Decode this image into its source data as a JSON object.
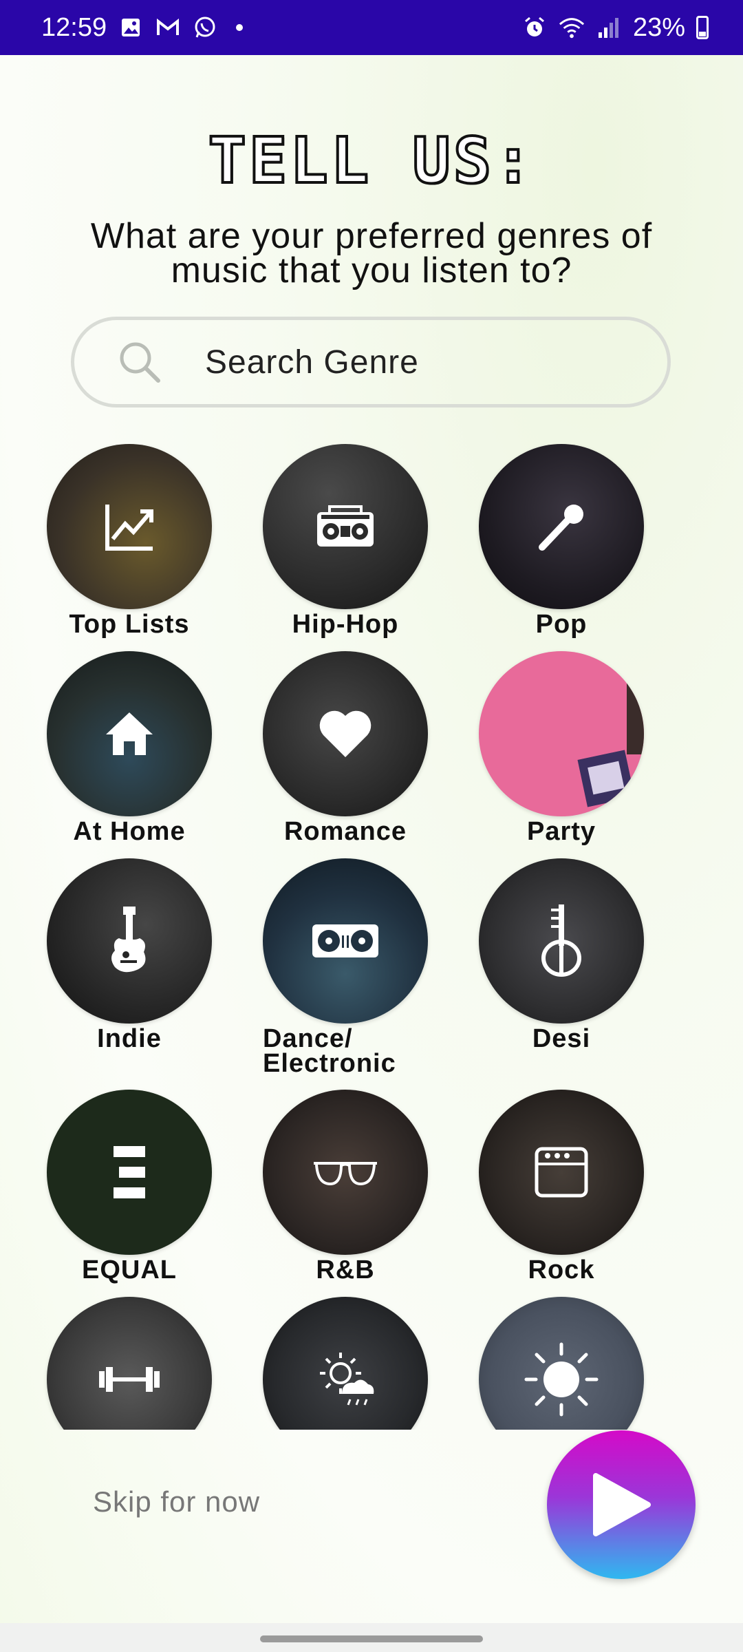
{
  "status_bar": {
    "time": "12:59",
    "battery": "23%",
    "left_icons": [
      "image-icon",
      "gmail-icon",
      "whatsapp-icon",
      "dot-icon"
    ],
    "right_icons": [
      "alarm-icon",
      "wifi-icon",
      "signal-icon",
      "battery-icon"
    ]
  },
  "title": "TELL US:",
  "subtitle": "What are your preferred genres of music that you listen to?",
  "search": {
    "placeholder": "Search Genre",
    "value": ""
  },
  "genres": [
    {
      "label": "Top Lists",
      "icon": "trending-chart-icon",
      "color": "#3a3228"
    },
    {
      "label": "Hip-Hop",
      "icon": "boombox-icon",
      "color": "#2b2b2b"
    },
    {
      "label": "Pop",
      "icon": "microphone-icon",
      "color": "#1e1b22"
    },
    {
      "label": "At Home",
      "icon": "home-icon",
      "color": "#27302f"
    },
    {
      "label": "Romance",
      "icon": "heart-icon",
      "color": "#2a2a2a"
    },
    {
      "label": "Party",
      "icon": "party-image",
      "color": "#e86a9a"
    },
    {
      "label": "Indie",
      "icon": "electric-guitar-icon",
      "color": "#262626"
    },
    {
      "label": "Dance/ Electronic",
      "icon": "turntable-icon",
      "color": "#203140"
    },
    {
      "label": "Desi",
      "icon": "sitar-icon",
      "color": "#2e2e30"
    },
    {
      "label": "EQUAL",
      "icon": "equal-logo-icon",
      "color": "#1d2a1b"
    },
    {
      "label": "R&B",
      "icon": "sunglasses-icon",
      "color": "#2c2624"
    },
    {
      "label": "Rock",
      "icon": "amplifier-icon",
      "color": "#2a2522"
    },
    {
      "label": "",
      "icon": "dumbbell-icon",
      "color": "#3b3b3b"
    },
    {
      "label": "",
      "icon": "weather-icon",
      "color": "#27292c"
    },
    {
      "label": "",
      "icon": "sun-icon",
      "color": "#4a5260"
    }
  ],
  "skip_label": "Skip for now",
  "accent_colors": {
    "status_bar": "#2a06a8",
    "play_gradient_top": "#d40ac8",
    "play_gradient_bottom": "#2fb8f0"
  }
}
